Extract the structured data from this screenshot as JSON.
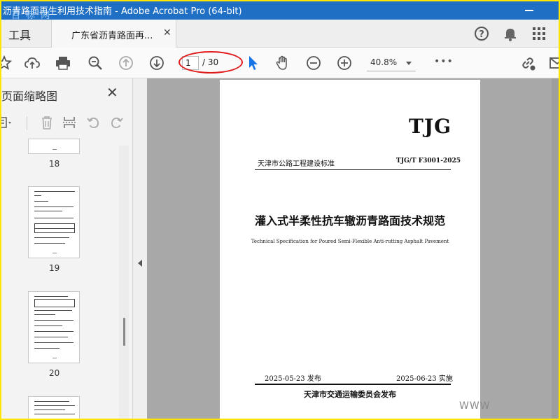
{
  "window": {
    "title": "沥青路面再生利用技术指南 - Adobe Acrobat Pro (64-bit)",
    "watermark": "百 标 网"
  },
  "tabs": {
    "tools_label": "工具",
    "doc_label": "广东省沥青路面再..."
  },
  "toolbar": {
    "page_current": "1",
    "page_total": "/ 30",
    "zoom": "40.8%",
    "more": "•••"
  },
  "sidebar": {
    "title": "页面缩略图",
    "thumbnails": [
      {
        "page": "18"
      },
      {
        "page": "19"
      },
      {
        "page": "20"
      }
    ]
  },
  "document": {
    "logo": "TJG",
    "org": "天津市公路工程建设标准",
    "code": "TJG/T F3001-2025",
    "title": "灌入式半柔性抗车辙沥青路面技术规范",
    "subtitle": "Technical Specification for Poured Semi-Flexible Anti-rutting Asphalt Pavement",
    "issue_date": "2025-05-23 发布",
    "effective_date": "2025-06-23 实施",
    "publisher": "天津市交通运输委员会发布"
  },
  "overlay": {
    "watermark_bottom": "WWW"
  }
}
